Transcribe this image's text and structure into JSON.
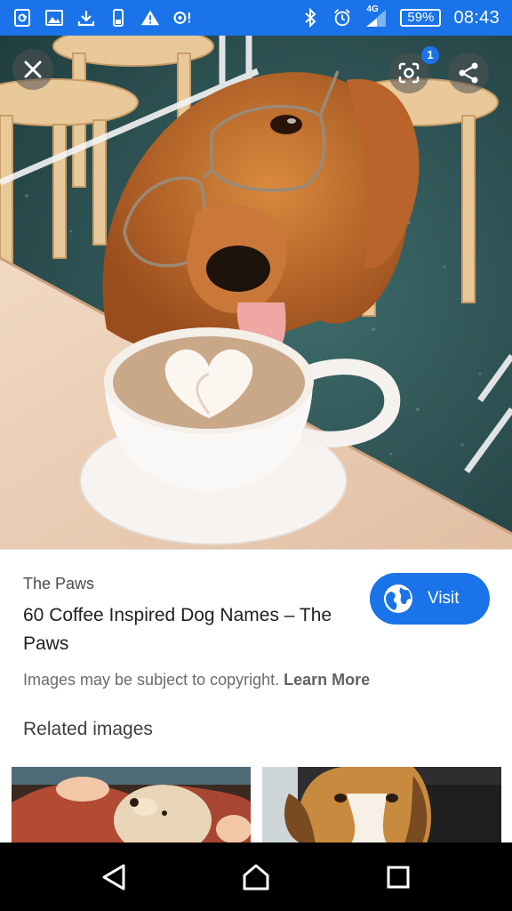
{
  "status_bar": {
    "time": "08:43",
    "battery_percent": "59%",
    "battery_level": 0.59,
    "network_label": "4G",
    "left_icons": [
      "screenshot-icon",
      "gallery-icon",
      "download-icon",
      "device-icon",
      "warning-icon",
      "sync-alert-icon"
    ],
    "right_icons": [
      "bluetooth-icon",
      "alarm-icon",
      "signal-icon",
      "battery-icon"
    ]
  },
  "viewer": {
    "close_icon": "close-icon",
    "lens_icon": "lens-icon",
    "lens_badge": "1",
    "share_icon": "share-icon"
  },
  "result": {
    "source": "The Paws",
    "title": "60 Coffee Inspired Dog Names – The Paws",
    "visit_label": "Visit",
    "visit_icon": "globe-icon",
    "copyright_text": "Images may be subject to copyright.",
    "learn_more_label": "Learn More"
  },
  "related": {
    "heading": "Related images",
    "thumbnails": [
      "dog-with-person-thumbnail",
      "beagle-in-car-thumbnail"
    ]
  },
  "nav_bar": {
    "icons": [
      "back-icon",
      "home-icon",
      "recents-icon"
    ]
  },
  "colors": {
    "accent": "#1a73e8",
    "nav_bar": "#000000",
    "title_text": "#202124"
  }
}
